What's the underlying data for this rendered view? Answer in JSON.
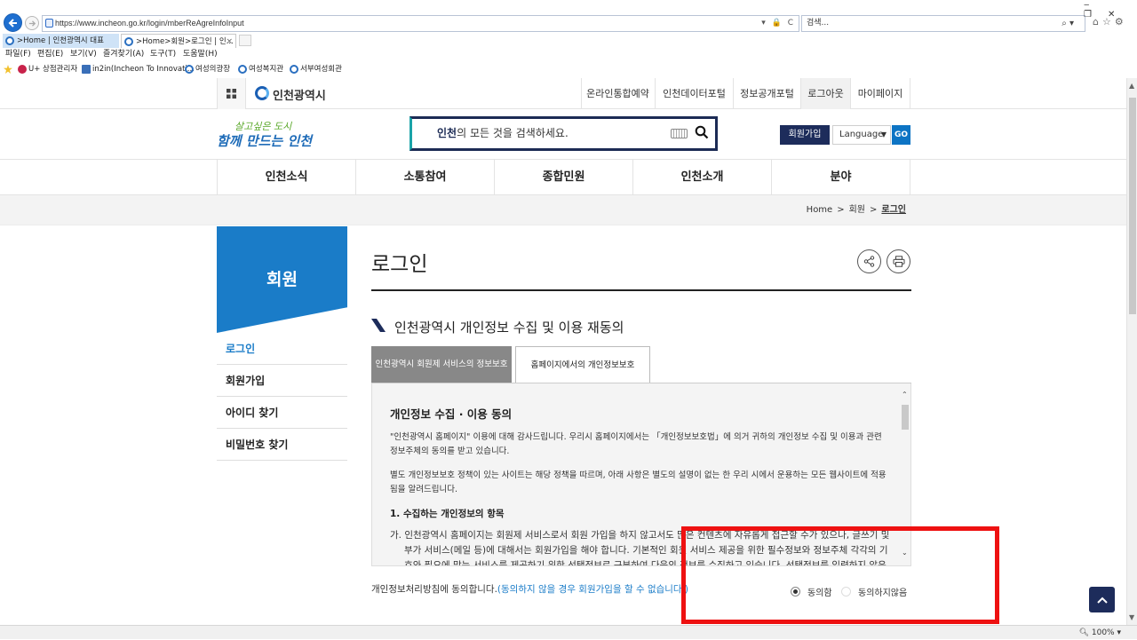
{
  "browser": {
    "url": "https://www.incheon.go.kr/login/mberReAgreInfoInput",
    "url_icons": "▾ 🔒 C",
    "search_placeholder": "검색...",
    "search_icon": "⌕ ▾",
    "tabs": [
      {
        "label": ">Home | 인천광역시 대표"
      },
      {
        "label": ">Home>회원>로그인 | 인..."
      }
    ],
    "tab_close": "×",
    "menu": [
      "파일(F)",
      "편집(E)",
      "보기(V)",
      "즐겨찾기(A)",
      "도구(T)",
      "도움말(H)"
    ],
    "favorites": [
      "U+ 상점관리자",
      "in2in(Incheon To Innovati...",
      "여성의광장",
      "여성복지관",
      "서부여성회관"
    ],
    "zoom": "100%"
  },
  "site": {
    "logo_text": "인천광역시",
    "util_links": [
      "온라인통합예약",
      "인천데이터포털",
      "정보공개포털",
      "로그아웃",
      "마이페이지"
    ],
    "slogan_line1": "살고싶은 도시",
    "slogan_line2": "함께 만드는 인천",
    "search_keyword": "인천",
    "search_rest": "의 모든 것을 검색하세요.",
    "join_label": "회원가입",
    "language_label": "Language",
    "go_label": "GO",
    "gnb": [
      "인천소식",
      "소통참여",
      "종합민원",
      "인천소개",
      "분야"
    ],
    "breadcrumb": [
      "Home",
      "회원",
      "로그인"
    ]
  },
  "lnb": {
    "title": "회원",
    "items": [
      "로그인",
      "회원가입",
      "아이디 찾기",
      "비밀번호 찾기"
    ]
  },
  "content": {
    "page_title": "로그인",
    "section_title": "인천광역시 개인정보 수집 및 이용 재동의",
    "tabs": [
      "인천광역시 회원제 서비스의 정보보호",
      "홈페이지에서의 개인정보보호"
    ],
    "policy": {
      "heading": "개인정보 수집 · 이용 동의",
      "para1": "\"인천광역시 홈페이지\" 이용에 대해 감사드립니다. 우리시 홈페이지에서는 「개인정보보호법」에 의거 귀하의 개인정보 수집 및 이용과 관련 정보주체의 동의를 받고 있습니다.",
      "para2": "별도 개인정보보호 정책이 있는 사이트는 해당 정책을 따르며, 아래 사항은 별도의 설명이 없는 한 우리 시에서 운용하는 모든 웹사이트에 적용됨을 알려드립니다.",
      "sub": "1. 수집하는 개인정보의 항목",
      "item": "가. 인천광역시 홈페이지는 회원제 서비스로서 회원 가입을 하지 않고서도 많은 컨텐츠에 자유롭게 접근할 수가 있으나, 글쓰기 및 부가 서비스(메일 등)에 대해서는 회원가입을 해야 합니다. 기본적인 회원 서비스 제공을 위한 필수정보와 정보주체 각각의 기호와 필요에 맞는 서비스를 제공하기 위한 선택정보로 구분하여 다음의 정보를 수집하고 있습니다. 선택정보를 입력하지 않은"
    },
    "agree_text": "개인정보처리방침에 동의합니다.",
    "agree_warning": "(동의하지 않을 경우 회원가입을 할 수 없습니다.)",
    "radio_agree": "동의함",
    "radio_disagree": "동의하지않음",
    "radio_selected": "동의함"
  },
  "colors": {
    "primary_blue": "#1a7cc8",
    "navy": "#1d2c5b",
    "highlight_red": "#ee1111"
  }
}
